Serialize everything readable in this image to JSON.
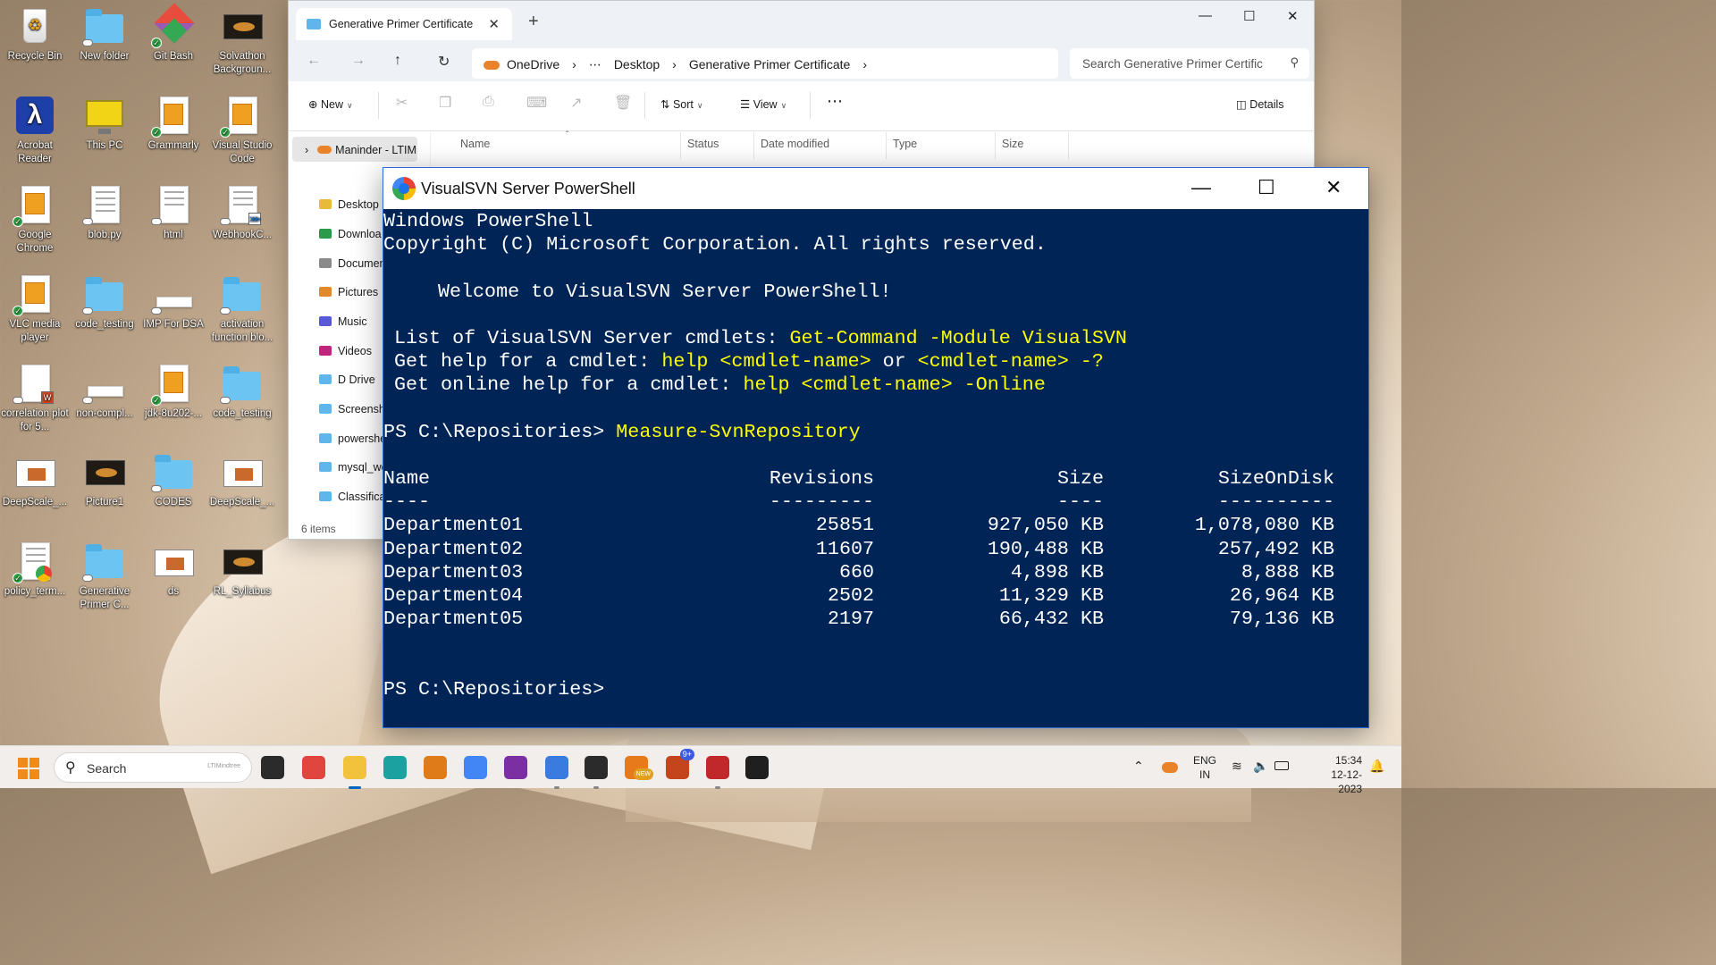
{
  "desktop": {
    "icons": [
      {
        "label": "Recycle Bin",
        "icon": "recycle-bin-icon"
      },
      {
        "label": "New folder",
        "icon": "folder-icon"
      },
      {
        "label": "Git Bash",
        "icon": "git-bash-icon"
      },
      {
        "label": "Solvathon Backgroun...",
        "icon": "image-file-icon"
      },
      {
        "label": "Acrobat Reader",
        "icon": "acrobat-reader-icon"
      },
      {
        "label": "This PC",
        "icon": "this-pc-icon"
      },
      {
        "label": "Grammarly",
        "icon": "shortcut-icon"
      },
      {
        "label": "Visual Studio Code",
        "icon": "shortcut-icon"
      },
      {
        "label": "Google Chrome",
        "icon": "shortcut-icon"
      },
      {
        "label": "blob.py",
        "icon": "python-file-icon"
      },
      {
        "label": "html",
        "icon": "html-file-icon"
      },
      {
        "label": "WebhookC...",
        "icon": "vs-file-icon"
      },
      {
        "label": "VLC media player",
        "icon": "shortcut-icon"
      },
      {
        "label": "code_testing",
        "icon": "folder-icon"
      },
      {
        "label": "IMP For DSA",
        "icon": "document-icon"
      },
      {
        "label": "activation function blo...",
        "icon": "folder-icon"
      },
      {
        "label": "correlation plot for 5...",
        "icon": "word-file-icon"
      },
      {
        "label": "non-compl...",
        "icon": "document-icon"
      },
      {
        "label": "jdk-8u202-...",
        "icon": "shortcut-icon"
      },
      {
        "label": "code_testing",
        "icon": "folder-icon"
      },
      {
        "label": "DeepScale_...",
        "icon": "video-file-icon"
      },
      {
        "label": "Picture1",
        "icon": "image-file-icon"
      },
      {
        "label": "CODES",
        "icon": "folder-icon"
      },
      {
        "label": "DeepScale_...",
        "icon": "video-file-icon"
      },
      {
        "label": "policy_term...",
        "icon": "chrome-document-icon"
      },
      {
        "label": "Generative Primer C...",
        "icon": "folder-icon"
      },
      {
        "label": "ds",
        "icon": "video-file-icon"
      },
      {
        "label": "RL_Syllabus",
        "icon": "image-file-icon"
      }
    ]
  },
  "explorer": {
    "tab_title": "Generative Primer Certificate",
    "tab_icon": "folder-icon",
    "new_tab": "+",
    "window_controls": {
      "minimize": "—",
      "maximize": "☐",
      "close": "✕"
    },
    "nav": {
      "back": "←",
      "forward": "→",
      "up": "↑",
      "refresh": "↻"
    },
    "breadcrumb": [
      "OneDrive",
      "›",
      "⋯",
      "Desktop",
      "›",
      "Generative Primer Certificate",
      "›"
    ],
    "search_placeholder": "Search Generative Primer Certific",
    "toolbar": {
      "new": "New",
      "sort": "Sort",
      "view": "View",
      "more": "⋯",
      "details": "Details"
    },
    "nav_root": "Maninder - LTIM",
    "nav_items": [
      "Desktop",
      "Downloa",
      "Documen",
      "Pictures",
      "Music",
      "Videos",
      "D Drive",
      "Screensho",
      "powershe",
      "mysql_wo",
      "Classifica"
    ],
    "columns": [
      "Name",
      "Status",
      "Date modified",
      "Type",
      "Size"
    ],
    "status": "6 items"
  },
  "powershell": {
    "title": "VisualSVN Server PowerShell",
    "controls": {
      "minimize": "—",
      "maximize": "☐",
      "close": "✕"
    },
    "header_line1": "Windows PowerShell",
    "header_line2": "Copyright (C) Microsoft Corporation. All rights reserved.",
    "welcome": "Welcome to VisualSVN Server PowerShell!",
    "help": [
      {
        "text": "List of VisualSVN Server cmdlets: ",
        "cmd": "Get-Command -Module VisualSVN"
      },
      {
        "text": "Get help for a cmdlet: ",
        "cmd": "help <cmdlet-name>",
        "mid": " or ",
        "cmd2": "<cmdlet-name> -?"
      },
      {
        "text": "Get online help for a cmdlet: ",
        "cmd": "help <cmdlet-name> -Online"
      }
    ],
    "prompt": "PS C:\\Repositories> ",
    "command": "Measure-SvnRepository",
    "table": {
      "headers": [
        "Name",
        "Revisions",
        "Size",
        "SizeOnDisk"
      ],
      "underlines": [
        "----",
        "---------",
        "----",
        "----------"
      ],
      "rows": [
        [
          "Department01",
          "25851",
          "927,050 KB",
          "1,078,080 KB"
        ],
        [
          "Department02",
          "11607",
          "190,488 KB",
          "257,492 KB"
        ],
        [
          "Department03",
          "660",
          "4,898 KB",
          "8,888 KB"
        ],
        [
          "Department04",
          "2502",
          "11,329 KB",
          "26,964 KB"
        ],
        [
          "Department05",
          "2197",
          "66,432 KB",
          "79,136 KB"
        ]
      ]
    },
    "final_prompt": "PS C:\\Repositories>"
  },
  "taskbar": {
    "search_label": "Search",
    "search_logo": "LTIMindtree",
    "apps": [
      {
        "name": "task-view-icon",
        "color": "#2b2b2b"
      },
      {
        "name": "video-chat-icon",
        "color": "#e0463e"
      },
      {
        "name": "file-explorer-icon",
        "color": "#f3c23c"
      },
      {
        "name": "edge-icon",
        "color": "#1aa1a0"
      },
      {
        "name": "store-icon",
        "color": "#e07b1a"
      },
      {
        "name": "chrome-icon",
        "color": "#4285f4"
      },
      {
        "name": "onenote-icon",
        "color": "#7b2fa3"
      },
      {
        "name": "visualsvn-icon",
        "color": "#3a7be0"
      },
      {
        "name": "terminal-icon",
        "color": "#2b2b2b"
      },
      {
        "name": "outlook-icon",
        "color": "#e77a1a"
      },
      {
        "name": "teams-icon",
        "color": "#c4451b"
      },
      {
        "name": "tortoise-icon",
        "color": "#c0282c"
      },
      {
        "name": "speedometer-icon",
        "color": "#1f1f1f"
      }
    ],
    "teams_badge": "9+",
    "new_badge": "NEW",
    "lang_top": "ENG",
    "lang_bottom": "IN",
    "time": "15:34",
    "date": "12-12-2023"
  }
}
